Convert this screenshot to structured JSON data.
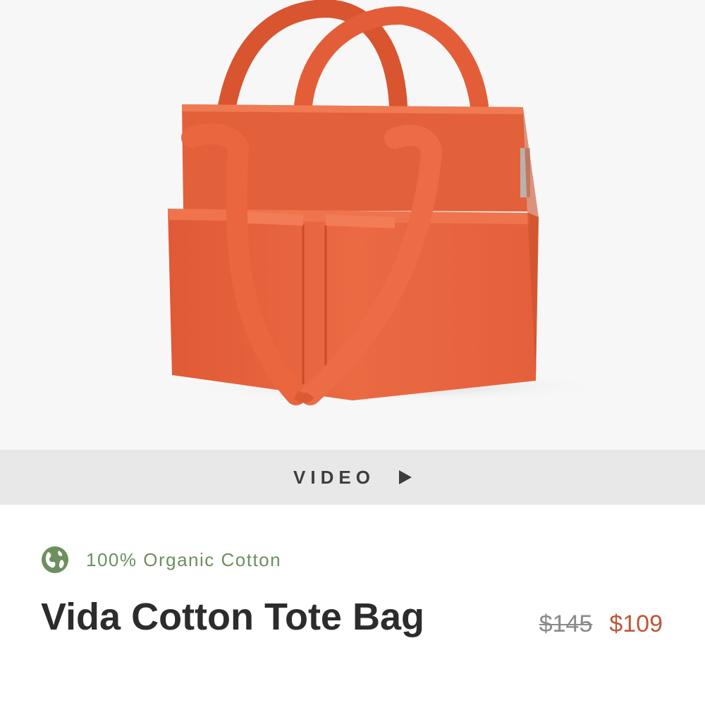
{
  "product_image": {
    "alt": "",
    "bag_color": "#e8623d",
    "background": "#f7f7f7"
  },
  "video_bar": {
    "label": "VIDEO",
    "icon": "play-icon"
  },
  "badge": {
    "icon": "globe-icon",
    "icon_color": "#6c8f5e",
    "label": "100% Organic Cotton"
  },
  "product": {
    "title": "Vida Cotton Tote Bag",
    "price_original": "$145",
    "price_sale": "$109",
    "sale_color": "#c0553a"
  }
}
